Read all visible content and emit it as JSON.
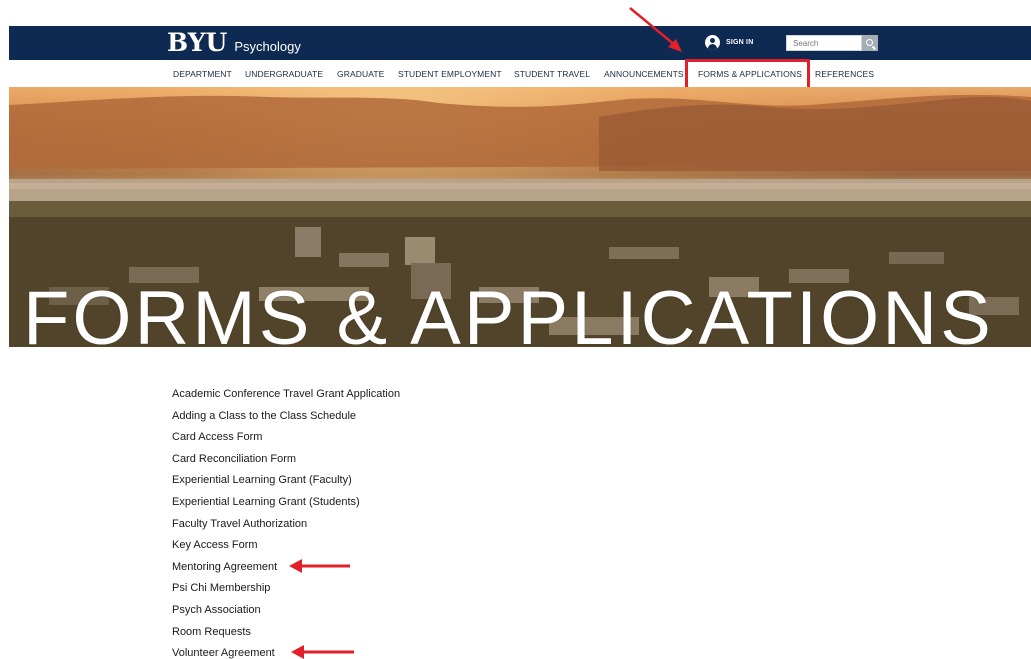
{
  "header": {
    "logo_text": "BYU",
    "department": "Psychology",
    "signin_label": "SIGN IN",
    "search_placeholder": "Search",
    "bar_color": "#0f2a52"
  },
  "nav": {
    "items": [
      "DEPARTMENT",
      "UNDERGRADUATE",
      "GRADUATE",
      "STUDENT EMPLOYMENT",
      "STUDENT TRAVEL",
      "ANNOUNCEMENTS",
      "FORMS & APPLICATIONS",
      "REFERENCES"
    ],
    "highlighted": "FORMS & APPLICATIONS",
    "highlight_color": "#e2202a"
  },
  "hero": {
    "title": "FORMS & APPLICATIONS"
  },
  "forms": {
    "links": [
      "Academic Conference Travel Grant Application",
      "Adding a Class to the Class Schedule",
      "Card Access Form",
      "Card Reconciliation Form",
      "Experiential Learning Grant (Faculty)",
      "Experiential Learning Grant (Students)",
      "Faculty Travel Authorization",
      "Key Access Form",
      "Mentoring Agreement",
      "Psi Chi Membership",
      "Psych Association",
      "Room Requests",
      "Volunteer Agreement"
    ],
    "annotated": [
      "Mentoring Agreement",
      "Volunteer Agreement"
    ]
  },
  "annotation_color": "#e2202a",
  "icons": {
    "signin": "user-circle-icon",
    "search": "search-icon",
    "arrow": "red-arrow-icon"
  }
}
